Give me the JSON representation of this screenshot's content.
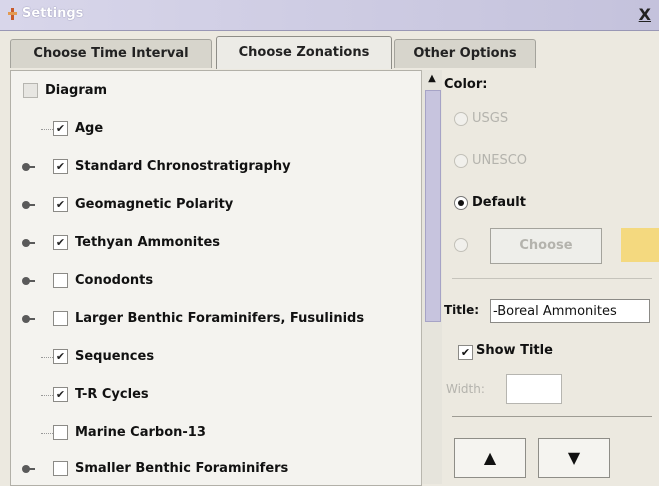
{
  "window": {
    "title": "Settings",
    "close": "X"
  },
  "tabs": [
    {
      "label": "Choose Time Interval",
      "active": false
    },
    {
      "label": "Choose Zonations",
      "active": true
    },
    {
      "label": "Other Options",
      "active": false
    }
  ],
  "tree": {
    "root": {
      "label": "Diagram",
      "checked": false,
      "disabled": true
    },
    "items": [
      {
        "label": "Age",
        "checked": true,
        "expandable": false
      },
      {
        "label": "Standard Chronostratigraphy",
        "checked": true,
        "expandable": true
      },
      {
        "label": "Geomagnetic Polarity",
        "checked": true,
        "expandable": true
      },
      {
        "label": "Tethyan Ammonites",
        "checked": true,
        "expandable": true
      },
      {
        "label": "Conodonts",
        "checked": false,
        "expandable": true
      },
      {
        "label": "Larger Benthic Foraminifers, Fusulinids",
        "checked": false,
        "expandable": true
      },
      {
        "label": "Sequences",
        "checked": true,
        "expandable": false
      },
      {
        "label": "T-R Cycles",
        "checked": true,
        "expandable": false
      },
      {
        "label": "Marine Carbon-13",
        "checked": false,
        "expandable": false
      },
      {
        "label": "Smaller Benthic Foraminifers",
        "checked": false,
        "expandable": true
      }
    ]
  },
  "scrollbar": {
    "up_arrow": "▲"
  },
  "options": {
    "color_label": "Color:",
    "color_options": [
      {
        "label": "USGS",
        "selected": false,
        "disabled": true
      },
      {
        "label": "UNESCO",
        "selected": false,
        "disabled": true
      },
      {
        "label": "Default",
        "selected": true,
        "disabled": false
      }
    ],
    "choose_button": "Choose",
    "swatch_color": "#f4d97f",
    "title_label": "Title:",
    "title_value": "-Boreal Ammonites",
    "show_title_label": "Show Title",
    "show_title_checked": true,
    "width_label": "Width:",
    "width_value": "",
    "up_button": "▲",
    "down_button": "▼"
  }
}
